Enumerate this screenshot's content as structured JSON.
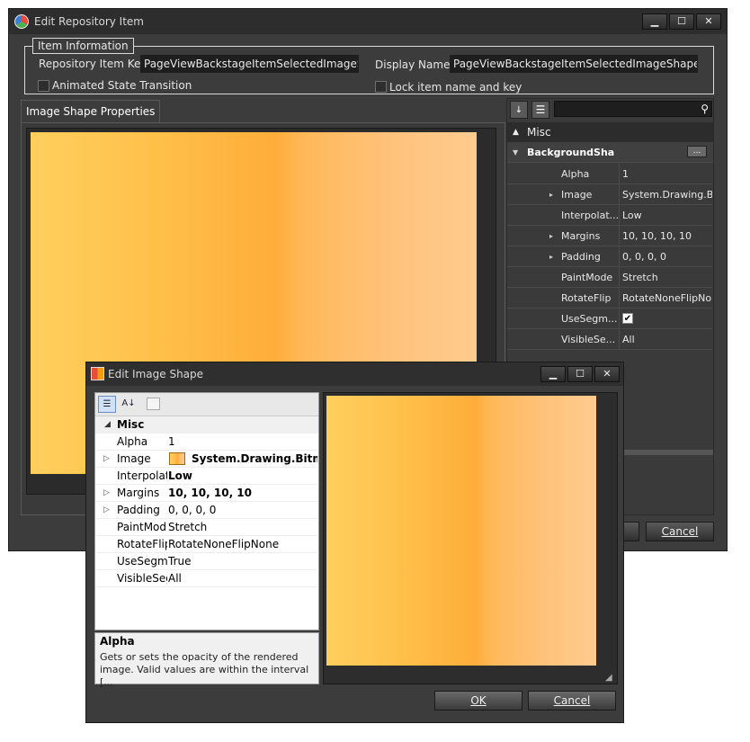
{
  "main_window": {
    "title": "Edit Repository Item",
    "controls": {
      "minimize": "▁",
      "maximize": "☐",
      "close": "✕"
    },
    "group_caption": "Item Information",
    "repo_key_label": "Repository Item Key :",
    "repo_key_value": "PageViewBackstageItemSelectedImageShape",
    "display_name_label": "Display Name :",
    "display_name_value": "PageViewBackstageItemSelectedImageShape",
    "animated_label": "Animated State Transition",
    "lock_label": "Lock item name and key",
    "tab_label": "Image Shape Properties",
    "cancel_label": "Cancel",
    "ok_partial": ""
  },
  "property_grid": {
    "category": "Misc",
    "parent": "BackgroundShape",
    "rows": [
      {
        "name": "Alpha",
        "value": "1",
        "expandable": false
      },
      {
        "name": "Image",
        "value": "System.Drawing.Bit",
        "expandable": true
      },
      {
        "name": "Interpolat...",
        "value": "Low",
        "expandable": false
      },
      {
        "name": "Margins",
        "value": "10, 10, 10, 10",
        "expandable": true
      },
      {
        "name": "Padding",
        "value": "0, 0, 0, 0",
        "expandable": true
      },
      {
        "name": "PaintMode",
        "value": "Stretch",
        "expandable": false
      },
      {
        "name": "RotateFlip",
        "value": "RotateNoneFlipNo",
        "expandable": false
      },
      {
        "name": "UseSegm...",
        "value": "",
        "expandable": false
      },
      {
        "name": "VisibleSe...",
        "value": "All",
        "expandable": false
      }
    ]
  },
  "dialog": {
    "title": "Edit Image Shape",
    "controls": {
      "minimize": "▁",
      "maximize": "☐",
      "close": "✕"
    },
    "category": "Misc",
    "rows": [
      {
        "name": "Alpha",
        "value": "1",
        "bold": false,
        "expandable": false
      },
      {
        "name": "Image",
        "value": "System.Drawing.Bitmap",
        "bold": true,
        "expandable": true
      },
      {
        "name": "Interpolat",
        "value": "Low",
        "bold": true,
        "expandable": false
      },
      {
        "name": "Margins",
        "value": "10, 10, 10, 10",
        "bold": true,
        "expandable": true
      },
      {
        "name": "Padding",
        "value": "0, 0, 0, 0",
        "bold": false,
        "expandable": true
      },
      {
        "name": "PaintMod",
        "value": "Stretch",
        "bold": false,
        "expandable": false
      },
      {
        "name": "RotateFlip",
        "value": "RotateNoneFlipNone",
        "bold": false,
        "expandable": false
      },
      {
        "name": "UseSegme",
        "value": "True",
        "bold": false,
        "expandable": false
      },
      {
        "name": "VisibleSeg",
        "value": "All",
        "bold": false,
        "expandable": false
      }
    ],
    "help_title": "Alpha",
    "help_text": "Gets or sets the opacity of the rendered image. Valid values are within the interval [...",
    "ok_label": "OK",
    "cancel_label": "Cancel"
  },
  "colors": {
    "gradient_start": "#ffcf5e",
    "gradient_mid": "#ffad3a",
    "gradient_end": "#ffcb8f",
    "dark_bg": "#3c3c3c"
  }
}
